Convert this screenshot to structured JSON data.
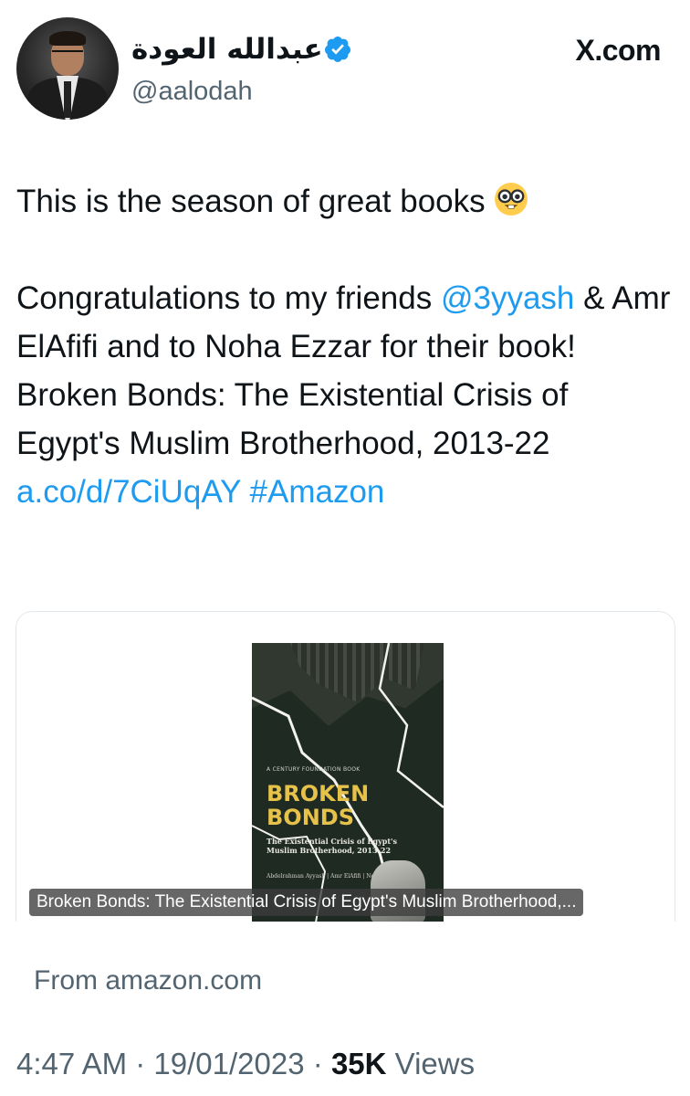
{
  "author": {
    "display_name": "عبدالله العودة",
    "handle": "@aalodah",
    "verified": true
  },
  "source_label": "X.com",
  "tweet": {
    "line1": "This is the season of great books",
    "line1_emoji": "nerd-face-emoji",
    "congrats_prefix": "Congratulations to my friends ",
    "mention": "@3yyash",
    "congrats_suffix": " & Amr ElAfifi and to Noha Ezzar for their book!",
    "book_line": "Broken Bonds: The Existential Crisis of Egypt's Muslim Brotherhood, 2013-22",
    "link": "a.co/d/7CiUqAY",
    "hashtag": "#Amazon"
  },
  "card": {
    "cover": {
      "series": "A CENTURY FOUNDATION BOOK",
      "title_line1": "BROKEN",
      "title_line2": "BONDS",
      "subtitle": "The Existential Crisis of Egypt's Muslim Brotherhood, 2013-22",
      "authors": "Abdelrahman Ayyash | Amr ElAfifi | Noha Ezzat"
    },
    "caption": "Broken Bonds: The Existential Crisis of Egypt's Muslim Brotherhood,...",
    "from": "From amazon.com"
  },
  "meta": {
    "time": "4:47 AM",
    "date": "19/01/2023",
    "views_count": "35K",
    "views_label": "Views"
  },
  "colors": {
    "link": "#1d9bf0",
    "verified": "#1d9bf0",
    "secondary_text": "#536471",
    "cover_title": "#e6c24a"
  }
}
